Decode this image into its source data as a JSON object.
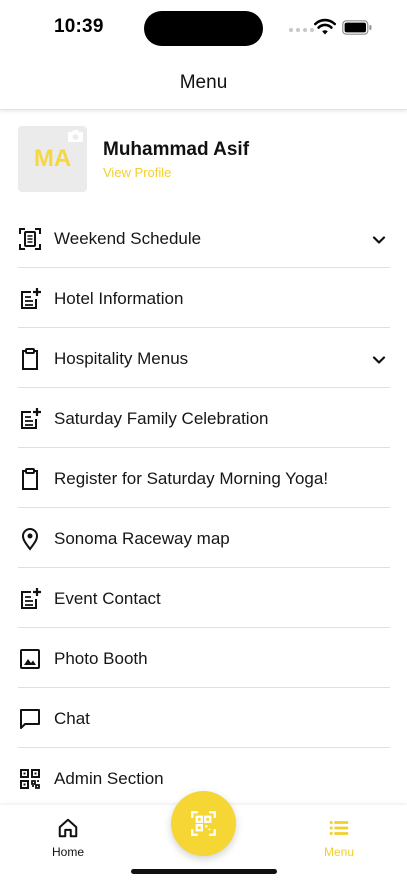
{
  "status_bar": {
    "time": "10:39",
    "icons": [
      "cellular-signal-icon",
      "wifi-icon",
      "battery-icon"
    ]
  },
  "header": {
    "title": "Menu"
  },
  "profile": {
    "initials": "MA",
    "name": "Muhammad Asif",
    "link_label": "View Profile",
    "accent_color": "#f2cf2f"
  },
  "menu": {
    "items": [
      {
        "label": "Weekend Schedule",
        "icon": "schedule-icon",
        "expandable": true
      },
      {
        "label": "Hotel Information",
        "icon": "note-add-icon",
        "expandable": false
      },
      {
        "label": "Hospitality Menus",
        "icon": "clipboard-icon",
        "expandable": true
      },
      {
        "label": "Saturday Family Celebration",
        "icon": "note-add-icon",
        "expandable": false
      },
      {
        "label": "Register for Saturday Morning Yoga!",
        "icon": "clipboard-icon",
        "expandable": false
      },
      {
        "label": "Sonoma Raceway map",
        "icon": "location-pin-icon",
        "expandable": false
      },
      {
        "label": "Event Contact",
        "icon": "note-add-icon",
        "expandable": false
      },
      {
        "label": "Photo Booth",
        "icon": "image-icon",
        "expandable": false
      },
      {
        "label": "Chat",
        "icon": "chat-icon",
        "expandable": false
      },
      {
        "label": "Admin Section",
        "icon": "qr-code-icon",
        "expandable": false
      }
    ]
  },
  "tab_bar": {
    "home_label": "Home",
    "menu_label": "Menu",
    "active_tab": "Menu",
    "fab_icon": "qr-scan-icon",
    "fab_color": "#f5d634"
  }
}
